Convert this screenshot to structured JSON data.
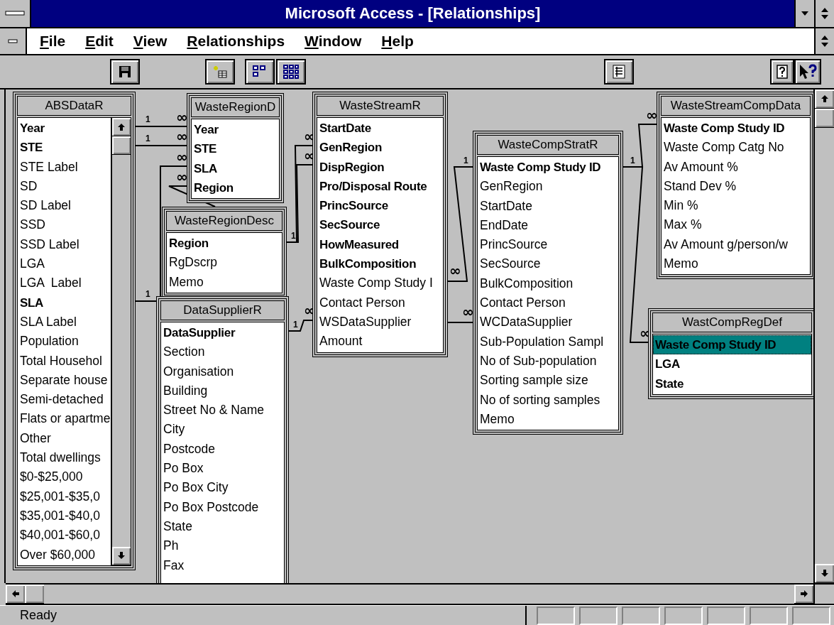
{
  "window": {
    "title": "Microsoft Access - [Relationships]"
  },
  "menu": [
    "File",
    "Edit",
    "View",
    "Relationships",
    "Window",
    "Help"
  ],
  "tables": [
    {
      "title": "ABSDataR",
      "has_scrollbar": true,
      "fields": [
        {
          "name": "Year",
          "bold": true,
          "selected": false
        },
        {
          "name": "STE",
          "bold": true,
          "selected": false
        },
        {
          "name": "STE Label",
          "bold": false,
          "selected": false
        },
        {
          "name": "SD",
          "bold": false,
          "selected": false
        },
        {
          "name": "SD Label",
          "bold": false,
          "selected": false
        },
        {
          "name": "SSD",
          "bold": false,
          "selected": false
        },
        {
          "name": "SSD Label",
          "bold": false,
          "selected": false
        },
        {
          "name": "LGA",
          "bold": false,
          "selected": false
        },
        {
          "name": "LGA  Label",
          "bold": false,
          "selected": false
        },
        {
          "name": "SLA",
          "bold": true,
          "selected": false
        },
        {
          "name": "SLA Label",
          "bold": false,
          "selected": false
        },
        {
          "name": "Population",
          "bold": false,
          "selected": false
        },
        {
          "name": "Total Househol",
          "bold": false,
          "selected": false
        },
        {
          "name": "Separate house",
          "bold": false,
          "selected": false
        },
        {
          "name": "Semi-detached",
          "bold": false,
          "selected": false
        },
        {
          "name": "Flats or apartme",
          "bold": false,
          "selected": false
        },
        {
          "name": "Other",
          "bold": false,
          "selected": false
        },
        {
          "name": "Total dwellings",
          "bold": false,
          "selected": false
        },
        {
          "name": "$0-$25,000",
          "bold": false,
          "selected": false
        },
        {
          "name": "$25,001-$35,0",
          "bold": false,
          "selected": false
        },
        {
          "name": "$35,001-$40,0",
          "bold": false,
          "selected": false
        },
        {
          "name": "$40,001-$60,0",
          "bold": false,
          "selected": false
        },
        {
          "name": "Over $60,000",
          "bold": false,
          "selected": false
        }
      ]
    },
    {
      "title": "WasteRegionD",
      "has_scrollbar": false,
      "fields": [
        {
          "name": "Year",
          "bold": true,
          "selected": false
        },
        {
          "name": "STE",
          "bold": true,
          "selected": false
        },
        {
          "name": "SLA",
          "bold": true,
          "selected": false
        },
        {
          "name": "Region",
          "bold": true,
          "selected": false
        }
      ]
    },
    {
      "title": "WasteRegionDesc",
      "has_scrollbar": false,
      "fields": [
        {
          "name": "Region",
          "bold": true,
          "selected": false
        },
        {
          "name": "RgDscrp",
          "bold": false,
          "selected": false
        },
        {
          "name": "Memo",
          "bold": false,
          "selected": false
        }
      ]
    },
    {
      "title": "DataSupplierR",
      "has_scrollbar": false,
      "fields": [
        {
          "name": "DataSupplier",
          "bold": true,
          "selected": false
        },
        {
          "name": "Section",
          "bold": false,
          "selected": false
        },
        {
          "name": "Organisation",
          "bold": false,
          "selected": false
        },
        {
          "name": "Building",
          "bold": false,
          "selected": false
        },
        {
          "name": "Street No & Name",
          "bold": false,
          "selected": false
        },
        {
          "name": "City",
          "bold": false,
          "selected": false
        },
        {
          "name": "Postcode",
          "bold": false,
          "selected": false
        },
        {
          "name": "Po Box",
          "bold": false,
          "selected": false
        },
        {
          "name": "Po Box City",
          "bold": false,
          "selected": false
        },
        {
          "name": "Po Box Postcode",
          "bold": false,
          "selected": false
        },
        {
          "name": "State",
          "bold": false,
          "selected": false
        },
        {
          "name": "Ph",
          "bold": false,
          "selected": false
        },
        {
          "name": "Fax",
          "bold": false,
          "selected": false
        }
      ]
    },
    {
      "title": "WasteStreamR",
      "has_scrollbar": false,
      "fields": [
        {
          "name": "StartDate",
          "bold": true,
          "selected": false
        },
        {
          "name": "GenRegion",
          "bold": true,
          "selected": false
        },
        {
          "name": "DispRegion",
          "bold": true,
          "selected": false
        },
        {
          "name": "Pro/Disposal Route",
          "bold": true,
          "selected": false
        },
        {
          "name": "PrincSource",
          "bold": true,
          "selected": false
        },
        {
          "name": "SecSource",
          "bold": true,
          "selected": false
        },
        {
          "name": "HowMeasured",
          "bold": true,
          "selected": false
        },
        {
          "name": "BulkComposition",
          "bold": true,
          "selected": false
        },
        {
          "name": "Waste Comp Study I",
          "bold": false,
          "selected": false
        },
        {
          "name": "Contact Person",
          "bold": false,
          "selected": false
        },
        {
          "name": "WSDataSupplier",
          "bold": false,
          "selected": false
        },
        {
          "name": "Amount",
          "bold": false,
          "selected": false
        }
      ]
    },
    {
      "title": "WasteCompStratR",
      "has_scrollbar": false,
      "fields": [
        {
          "name": "Waste Comp Study ID",
          "bold": true,
          "selected": false
        },
        {
          "name": "GenRegion",
          "bold": false,
          "selected": false
        },
        {
          "name": "StartDate",
          "bold": false,
          "selected": false
        },
        {
          "name": "EndDate",
          "bold": false,
          "selected": false
        },
        {
          "name": "PrincSource",
          "bold": false,
          "selected": false
        },
        {
          "name": "SecSource",
          "bold": false,
          "selected": false
        },
        {
          "name": "BulkComposition",
          "bold": false,
          "selected": false
        },
        {
          "name": "Contact Person",
          "bold": false,
          "selected": false
        },
        {
          "name": "WCDataSupplier",
          "bold": false,
          "selected": false
        },
        {
          "name": "Sub-Population Sampl",
          "bold": false,
          "selected": false
        },
        {
          "name": "No of Sub-population",
          "bold": false,
          "selected": false
        },
        {
          "name": "Sorting sample size",
          "bold": false,
          "selected": false
        },
        {
          "name": "No of sorting samples",
          "bold": false,
          "selected": false
        },
        {
          "name": "Memo",
          "bold": false,
          "selected": false
        }
      ]
    },
    {
      "title": "WasteStreamCompData",
      "has_scrollbar": false,
      "fields": [
        {
          "name": "Waste Comp Study ID",
          "bold": true,
          "selected": false
        },
        {
          "name": "Waste Comp Catg No",
          "bold": false,
          "selected": false
        },
        {
          "name": "Av Amount %",
          "bold": false,
          "selected": false
        },
        {
          "name": "Stand Dev %",
          "bold": false,
          "selected": false
        },
        {
          "name": "Min %",
          "bold": false,
          "selected": false
        },
        {
          "name": "Max %",
          "bold": false,
          "selected": false
        },
        {
          "name": "Av Amount g/person/w",
          "bold": false,
          "selected": false
        },
        {
          "name": "Memo",
          "bold": false,
          "selected": false
        }
      ]
    },
    {
      "title": "WastCompRegDef",
      "has_scrollbar": false,
      "fields": [
        {
          "name": "Waste Comp Study ID",
          "bold": true,
          "selected": true
        },
        {
          "name": "LGA",
          "bold": true,
          "selected": false
        },
        {
          "name": "State",
          "bold": true,
          "selected": false
        }
      ]
    }
  ],
  "relationships": [
    {
      "one": "1",
      "many": "∞"
    },
    {
      "one": "1",
      "many": "∞"
    },
    {
      "one": "1",
      "many": "∞"
    },
    {
      "many": "∞"
    },
    {
      "one": "1",
      "many": "∞"
    },
    {
      "many": "∞"
    },
    {
      "one": "1",
      "many": "∞"
    },
    {
      "one": "1",
      "many": "∞"
    },
    {
      "many": "∞"
    },
    {
      "one": "1",
      "many": "∞"
    },
    {
      "many": "∞"
    }
  ],
  "status_bar": {
    "text": "Ready"
  }
}
